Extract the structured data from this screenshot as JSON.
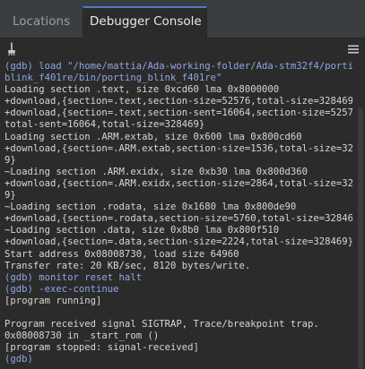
{
  "tabs": [
    {
      "label": "Locations",
      "active": false
    },
    {
      "label": "Debugger Console",
      "active": true
    }
  ],
  "toolbar": {
    "clear_icon": "broom-icon",
    "menu_icon": "hamburger-menu-icon"
  },
  "console": {
    "lines": [
      {
        "text": "(gdb) load \"/home/mattia/Ada-working-folder/Ada-stm32f4/porting_",
        "kind": "prompt"
      },
      {
        "text": "blink_f401re/bin/porting_blink_f401re\"",
        "kind": "prompt"
      },
      {
        "text": "Loading section .text, size 0xcd60 lma 0x8000000",
        "kind": "output"
      },
      {
        "text": "+download,{section=.text,section-size=52576,total-size=328469}",
        "kind": "output"
      },
      {
        "text": "+download,{section=.text,section-sent=16064,section-size=52576,",
        "kind": "output"
      },
      {
        "text": "total-sent=16064,total-size=328469}",
        "kind": "output"
      },
      {
        "text": "Loading section .ARM.extab, size 0x600 lma 0x800cd60",
        "kind": "output"
      },
      {
        "text": "+download,{section=.ARM.extab,section-size=1536,total-size=32846",
        "kind": "output"
      },
      {
        "text": "9}",
        "kind": "output"
      },
      {
        "text": "~Loading section .ARM.exidx, size 0xb30 lma 0x800d360",
        "kind": "output"
      },
      {
        "text": "+download,{section=.ARM.exidx,section-size=2864,total-size=32846",
        "kind": "output"
      },
      {
        "text": "9}",
        "kind": "output"
      },
      {
        "text": "~Loading section .rodata, size 0x1680 lma 0x800de90",
        "kind": "output"
      },
      {
        "text": "+download,{section=.rodata,section-size=5760,total-size=328469}",
        "kind": "output"
      },
      {
        "text": "~Loading section .data, size 0x8b0 lma 0x800f510",
        "kind": "output"
      },
      {
        "text": "+download,{section=.data,section-size=2224,total-size=328469}",
        "kind": "output"
      },
      {
        "text": "Start address 0x08008730, load size 64960",
        "kind": "output"
      },
      {
        "text": "Transfer rate: 20 KB/sec, 8120 bytes/write.",
        "kind": "output"
      },
      {
        "text": "(gdb) monitor reset halt",
        "kind": "prompt"
      },
      {
        "text": "(gdb) -exec-continue",
        "kind": "prompt"
      },
      {
        "text": "[program running]",
        "kind": "output"
      },
      {
        "text": "",
        "kind": "output"
      },
      {
        "text": "Program received signal SIGTRAP, Trace/breakpoint trap.",
        "kind": "output"
      },
      {
        "text": "0x08008730 in _start_rom ()",
        "kind": "output"
      },
      {
        "text": "[program stopped: signal-received]",
        "kind": "output"
      },
      {
        "text": "(gdb)",
        "kind": "prompt"
      }
    ]
  },
  "colors": {
    "background": "#2b2b2b",
    "tabbar": "#3b3e40",
    "active_tab_accent": "#4a7bc7",
    "output_text": "#d6d6d6",
    "prompt_text": "#8fa5e6"
  }
}
